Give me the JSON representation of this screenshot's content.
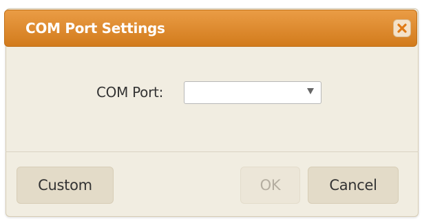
{
  "dialog": {
    "title": "COM Port Settings",
    "close_icon": "close-x-icon",
    "accent_color": "#dd8a2c",
    "field": {
      "label": "COM Port:",
      "selected_value": ""
    },
    "buttons": {
      "custom_label": "Custom",
      "ok_label": "OK",
      "ok_disabled": true,
      "cancel_label": "Cancel"
    }
  }
}
